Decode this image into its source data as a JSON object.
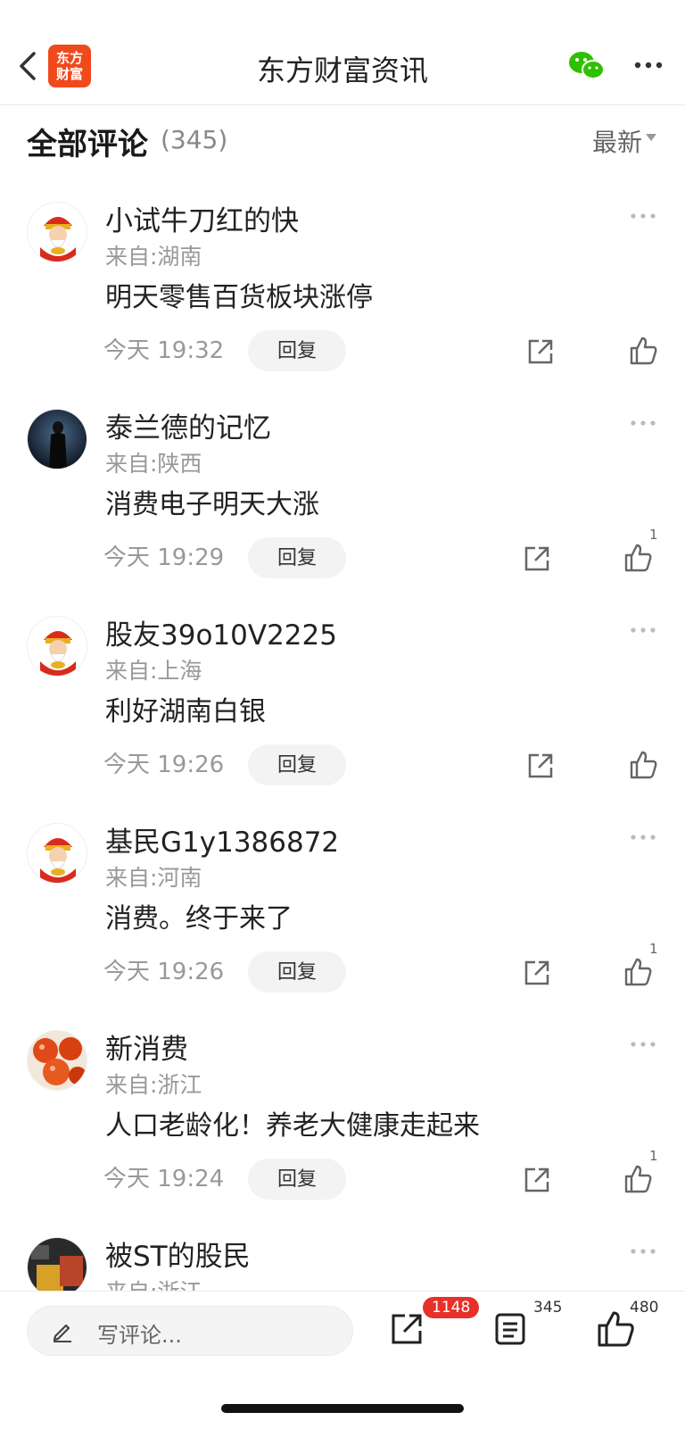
{
  "header": {
    "title": "东方财富资讯",
    "logo_text_line1": "东方",
    "logo_text_line2": "财富",
    "icons": [
      "back-icon",
      "wechat-icon",
      "more-icon"
    ]
  },
  "comments_header": {
    "title": "全部评论",
    "count": "(345)",
    "sort_label": "最新"
  },
  "comments": [
    {
      "user": "小试牛刀红的快",
      "location": "来自:湖南",
      "text": "明天零售百货板块涨停",
      "time": "今天 19:32",
      "reply_label": "回复",
      "likes": "",
      "avatar": "fortune-god"
    },
    {
      "user": "泰兰德的记忆",
      "location": "来自:陕西",
      "text": "消费电子明天大涨",
      "time": "今天 19:29",
      "reply_label": "回复",
      "likes": "1",
      "avatar": "dark-figure"
    },
    {
      "user": "股友39o10V2225",
      "location": "来自:上海",
      "text": "利好湖南白银",
      "time": "今天 19:26",
      "reply_label": "回复",
      "likes": "",
      "avatar": "fortune-god"
    },
    {
      "user": "基民G1y1386872",
      "location": "来自:河南",
      "text": "消费。终于来了",
      "time": "今天 19:26",
      "reply_label": "回复",
      "likes": "1",
      "avatar": "fortune-god"
    },
    {
      "user": "新消费",
      "location": "来自:浙江",
      "text": "人口老龄化！养老大健康走起来",
      "time": "今天 19:24",
      "reply_label": "回复",
      "likes": "1",
      "avatar": "tomatoes"
    },
    {
      "user": "被ST的股民",
      "location": "来自:浙江",
      "text": "",
      "time": "",
      "reply_label": "",
      "likes": "",
      "avatar": "photo"
    }
  ],
  "bottom_bar": {
    "input_placeholder": "写评论...",
    "share_badge": "1148",
    "comment_count": "345",
    "like_count": "480"
  },
  "colors": {
    "brand": "#f04a1c",
    "badge": "#e8302a",
    "wechat": "#2dc100"
  }
}
